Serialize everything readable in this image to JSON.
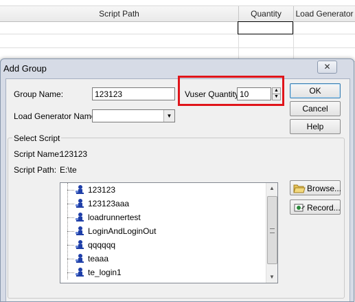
{
  "background_table": {
    "columns": [
      "Script Path",
      "Quantity",
      "Load Generator"
    ]
  },
  "dialog": {
    "title": "Add Group",
    "close_label": "✕",
    "group_name_label": "Group Name:",
    "group_name_value": "123123",
    "vuser_quantity_label": "Vuser Quantity:",
    "vuser_quantity_value": "10",
    "load_generator_label": "Load Generator Name:",
    "load_generator_value": "",
    "buttons": {
      "ok": "OK",
      "cancel": "Cancel",
      "help": "Help"
    },
    "select_script": {
      "title": "Select Script",
      "script_name_label": "Script Name:",
      "script_name_value": "123123",
      "script_path_label": "Script Path:",
      "script_path_value": "E:\\te",
      "browse_label": "Browse...",
      "record_label": "Record...",
      "scripts": [
        "123123",
        "123123aaa",
        "loadrunnertest",
        "LoginAndLoginOut",
        "qqqqqq",
        "teaaa",
        "te_login1"
      ]
    }
  },
  "colors": {
    "highlight_box": "#e0141a",
    "dialog_frame": "#d6dbe6",
    "dialog_body": "#f0f0f0",
    "script_icon": "#1f3fa8"
  }
}
